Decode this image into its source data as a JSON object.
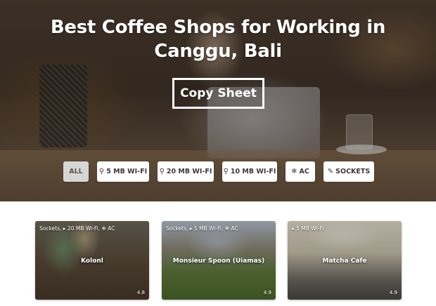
{
  "hero": {
    "title": "Best Coffee Shops for Working in Canggu, Bali",
    "copy_button_label": "Copy Sheet"
  },
  "filters": [
    {
      "label": "ALL",
      "icon": "",
      "active": true
    },
    {
      "label": "5 MB WI-FI",
      "icon": "wifi-icon",
      "active": false
    },
    {
      "label": "20 MB WI-FI",
      "icon": "wifi-icon",
      "active": false
    },
    {
      "label": "10 MB WI-FI",
      "icon": "wifi-icon",
      "active": false
    },
    {
      "label": "AC",
      "icon": "snowflake-icon",
      "active": false
    },
    {
      "label": "SOCKETS",
      "icon": "plug-icon",
      "active": false
    }
  ],
  "cards": [
    {
      "name": "Kolonl",
      "tags": "Sockets, ▸ 20 MB Wi-Fi, ❄ AC",
      "rating": "4.8"
    },
    {
      "name": "Monsieur Spoon (Uiamas)",
      "tags": "Sockets, ▸ 5 MB Wi-Fi, ❄ AC",
      "rating": "4.9"
    },
    {
      "name": "Matcha Cafe",
      "tags": "▸ 5 MB Wi-Fi",
      "rating": "4.9"
    }
  ],
  "colors": {
    "chip_active_bg": "#d6d6d6",
    "chip_bg": "#ffffff",
    "title_color": "#ffffff"
  }
}
